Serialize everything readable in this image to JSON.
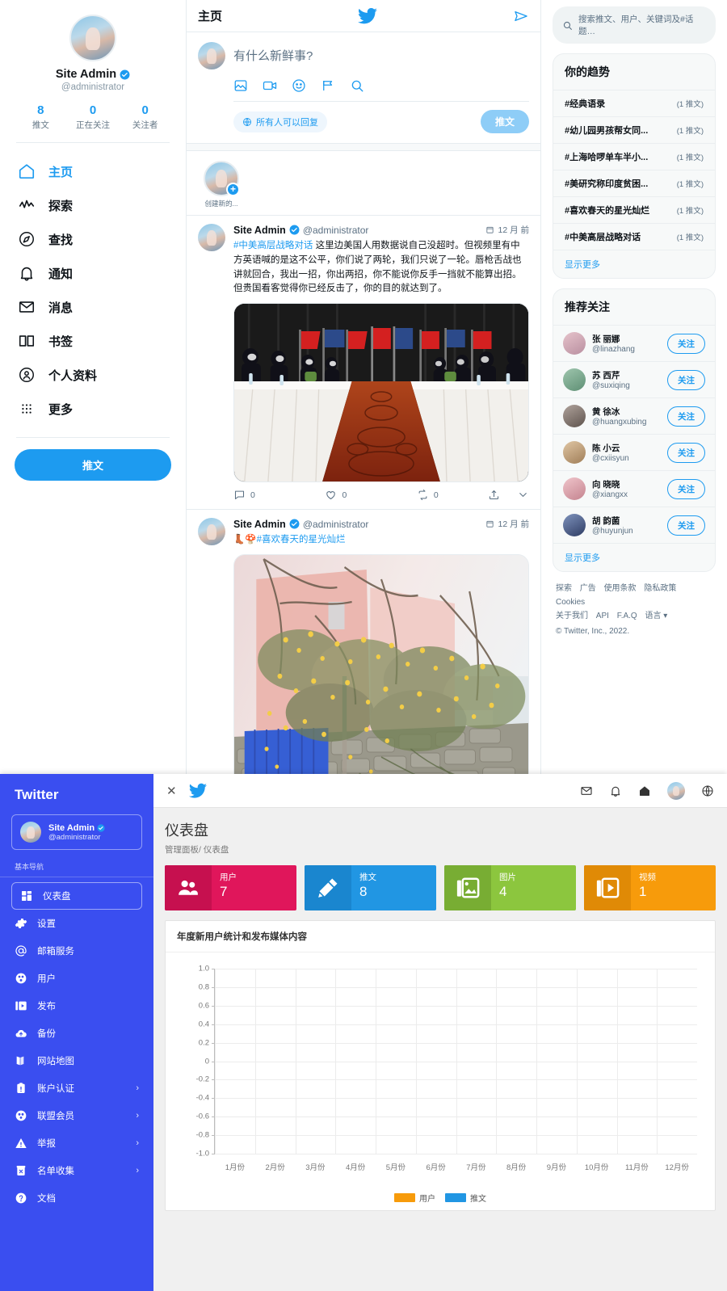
{
  "twitter": {
    "profile": {
      "display_name": "Site Admin",
      "handle": "@administrator",
      "stats": [
        {
          "num": "8",
          "label": "推文"
        },
        {
          "num": "0",
          "label": "正在关注"
        },
        {
          "num": "0",
          "label": "关注者"
        }
      ]
    },
    "nav": [
      {
        "label": "主页",
        "icon": "home-icon",
        "active": true
      },
      {
        "label": "探索",
        "icon": "pulse-icon",
        "active": false
      },
      {
        "label": "查找",
        "icon": "compass-icon",
        "active": false
      },
      {
        "label": "通知",
        "icon": "bell-icon",
        "active": false
      },
      {
        "label": "消息",
        "icon": "envelope-icon",
        "active": false
      },
      {
        "label": "书签",
        "icon": "bookmark-icon",
        "active": false
      },
      {
        "label": "个人资料",
        "icon": "person-icon",
        "active": false
      },
      {
        "label": "更多",
        "icon": "grid-dots-icon",
        "active": false
      }
    ],
    "tweet_button": "推文",
    "feed": {
      "title": "主页",
      "composer": {
        "placeholder": "有什么新鲜事?",
        "tools": [
          "image-icon",
          "video-icon",
          "emoji-icon",
          "poll-icon",
          "search-icon"
        ],
        "reply_scope": "所有人可以回复",
        "submit": "推文"
      },
      "fleets": {
        "create_label": "创建新的..."
      },
      "tweets": [
        {
          "name": "Site Admin",
          "handle": "@administrator",
          "time": "12 月 前",
          "hashtag": "#中美高层战略对话",
          "text": " 这里边美国人用数据说自己没超时。但视频里有中方英语喊的是这不公平，你们说了两轮，我们只说了一轮。唇枪舌战也讲就回合，我出一招，你出两招，你不能说你反手一挡就不能算出招。但贵国看客觉得你已经反击了，你的目的就达到了。",
          "media": "meeting-photo",
          "actions": {
            "replies": "0",
            "likes": "0",
            "retweets": "0"
          }
        },
        {
          "name": "Site Admin",
          "handle": "@administrator",
          "time": "12 月 前",
          "emoji": "👢🍄",
          "hashtag": "#喜欢春天的星光灿烂",
          "text": "",
          "media": "spring-photo",
          "actions": {
            "replies": "",
            "likes": "",
            "retweets": ""
          }
        }
      ]
    },
    "right": {
      "search_placeholder": "搜索推文、用户、关键词及#话题…",
      "trends_title": "你的趋势",
      "trends": [
        {
          "tag": "#经典语录",
          "count": "(1 推文)"
        },
        {
          "tag": "#幼儿园男孩帮女同...",
          "count": "(1 推文)"
        },
        {
          "tag": "#上海哈啰单车半小...",
          "count": "(1 推文)"
        },
        {
          "tag": "#美研究称印度贫困...",
          "count": "(1 推文)"
        },
        {
          "tag": "#喜欢春天的星光灿烂",
          "count": "(1 推文)"
        },
        {
          "tag": "#中美高层战略对话",
          "count": "(1 推文)"
        }
      ],
      "trends_show_more": "显示更多",
      "who_title": "推荐关注",
      "who_to_follow": [
        {
          "name": "张 丽娜",
          "handle": "@linazhang",
          "follow": "关注",
          "av": "#d9b8c0"
        },
        {
          "name": "苏 西芹",
          "handle": "@suxiqing",
          "follow": "关注",
          "av": "#7fae9a"
        },
        {
          "name": "黄 徐冰",
          "handle": "@huangxubing",
          "follow": "关注",
          "av": "#8a7f7a"
        },
        {
          "name": "陈 小云",
          "handle": "@cxiisyun",
          "follow": "关注",
          "av": "#c7a98c"
        },
        {
          "name": "向 晓晓",
          "handle": "@xiangxx",
          "follow": "关注",
          "av": "#d9a7ae"
        },
        {
          "name": "胡 韵菌",
          "handle": "@huyunjun",
          "follow": "关注",
          "av": "#4c5e85"
        }
      ],
      "who_show_more": "显示更多",
      "footer_links_row1": [
        "探索",
        "广告",
        "使用条款",
        "隐私政策",
        "Cookies"
      ],
      "footer_links_row2": [
        "关于我们",
        "API",
        "F.A.Q",
        "语言 ▾"
      ],
      "copyright": "© Twitter, Inc., 2022."
    }
  },
  "admin": {
    "brand": "Twitter",
    "user": {
      "name": "Site Admin",
      "handle": "@administrator"
    },
    "group_label": "基本导航",
    "nav": [
      {
        "label": "仪表盘",
        "icon": "dashboard-icon",
        "active": true,
        "chevron": false
      },
      {
        "label": "设置",
        "icon": "gear-icon",
        "active": false,
        "chevron": false
      },
      {
        "label": "邮箱服务",
        "icon": "at-icon",
        "active": false,
        "chevron": false
      },
      {
        "label": "用户",
        "icon": "users-icon",
        "active": false,
        "chevron": false
      },
      {
        "label": "发布",
        "icon": "publish-icon",
        "active": false,
        "chevron": false
      },
      {
        "label": "备份",
        "icon": "cloud-upload-icon",
        "active": false,
        "chevron": false
      },
      {
        "label": "网站地图",
        "icon": "map-icon",
        "active": false,
        "chevron": false
      },
      {
        "label": "账户认证",
        "icon": "badge-icon",
        "active": false,
        "chevron": true
      },
      {
        "label": "联盟会员",
        "icon": "affiliate-icon",
        "active": false,
        "chevron": true
      },
      {
        "label": "举报",
        "icon": "warning-icon",
        "active": false,
        "chevron": true
      },
      {
        "label": "名单收集",
        "icon": "collect-icon",
        "active": false,
        "chevron": true
      },
      {
        "label": "文档",
        "icon": "help-icon",
        "active": false,
        "chevron": false
      }
    ],
    "topbar": {
      "close": "✕",
      "icons": [
        "envelope-icon",
        "bell-icon",
        "home-icon",
        "avatar",
        "globe-icon"
      ]
    },
    "page_title": "仪表盘",
    "breadcrumb": "管理面板/ 仪表盘",
    "stat_cards": [
      {
        "label": "用户",
        "value": "7",
        "color": "#e0165b",
        "icon_bg": "#c6104f",
        "icon": "users-icon"
      },
      {
        "label": "推文",
        "value": "8",
        "color": "#2196e3",
        "icon_bg": "#1a86cf",
        "icon": "pencil-icon"
      },
      {
        "label": "图片",
        "value": "4",
        "color": "#8cc63e",
        "icon_bg": "#78ad33",
        "icon": "image-icon"
      },
      {
        "label": "视频",
        "value": "1",
        "color": "#f79b0b",
        "icon_bg": "#e08a06",
        "icon": "video-icon"
      }
    ],
    "chart_data": {
      "type": "line",
      "title": "年度新用户统计和发布媒体内容",
      "categories": [
        "1月份",
        "2月份",
        "3月份",
        "4月份",
        "5月份",
        "6月份",
        "7月份",
        "8月份",
        "9月份",
        "10月份",
        "11月份",
        "12月份"
      ],
      "series": [
        {
          "name": "用户",
          "color": "#f79b0b",
          "values": [
            0,
            0,
            0,
            0,
            0,
            0,
            0,
            0,
            0,
            0,
            0,
            0
          ]
        },
        {
          "name": "推文",
          "color": "#2196e3",
          "values": [
            0,
            0,
            0,
            0,
            0,
            0,
            0,
            0,
            0,
            0,
            0,
            0
          ]
        }
      ],
      "yticks": [
        "1.0",
        "0.8",
        "0.6",
        "0.4",
        "0.2",
        "0",
        "-0.2",
        "-0.4",
        "-0.6",
        "-0.8",
        "-1.0"
      ],
      "ylim": [
        -1.0,
        1.0
      ],
      "xlabel": "",
      "ylabel": "",
      "grid": true,
      "legend_position": "bottom"
    }
  }
}
